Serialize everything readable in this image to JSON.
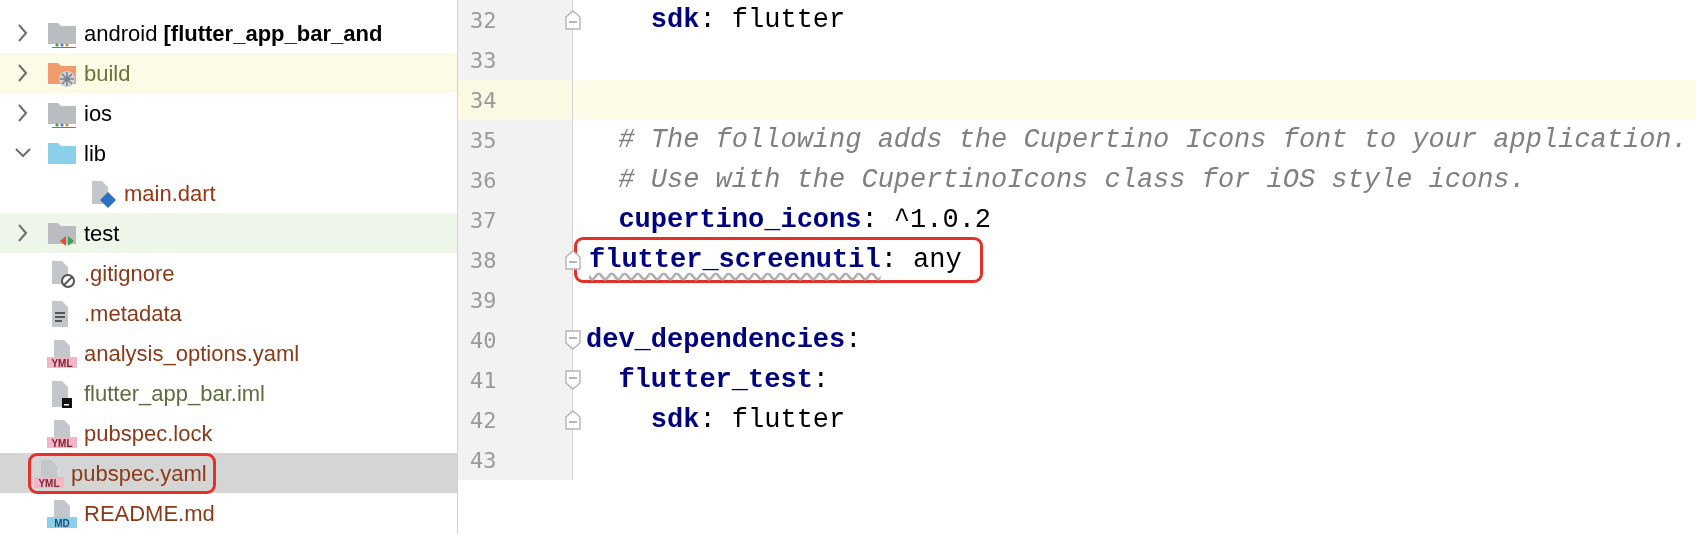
{
  "project_tree": {
    "items": [
      {
        "label": "android **[flutter_app_bar_and**",
        "kind": "module-folder",
        "expanded": false,
        "color": "#000000",
        "selected": false,
        "highlighted": false
      },
      {
        "label": "build",
        "kind": "excluded-folder",
        "expanded": false,
        "color": "#6b7337",
        "selected": false,
        "highlighted": false
      },
      {
        "label": "ios",
        "kind": "module-folder",
        "expanded": false,
        "color": "#000000",
        "selected": false,
        "highlighted": false
      },
      {
        "label": "lib",
        "kind": "source-folder",
        "expanded": true,
        "color": "#000000",
        "selected": false,
        "highlighted": false,
        "children": [
          {
            "label": "main.dart",
            "kind": "dart-file",
            "color": "#9a3412",
            "selected": false,
            "highlighted": false
          }
        ]
      },
      {
        "label": "test",
        "kind": "test-folder",
        "expanded": false,
        "color": "#000000",
        "selected": false,
        "highlighted": false
      },
      {
        "label": ".gitignore",
        "kind": "ignore-file",
        "color": "#8a3a17",
        "selected": false,
        "highlighted": false
      },
      {
        "label": ".metadata",
        "kind": "text-file",
        "color": "#8a3a17",
        "selected": false,
        "highlighted": false
      },
      {
        "label": "analysis_options.yaml",
        "kind": "badge-file",
        "badge": "YML",
        "color": "#8a3a17",
        "selected": false,
        "highlighted": false
      },
      {
        "label": "flutter_app_bar.iml",
        "kind": "iml-file",
        "color": "#5f6b3c",
        "selected": false,
        "highlighted": false
      },
      {
        "label": "pubspec.lock",
        "kind": "badge-file",
        "badge": "YML",
        "color": "#8a3a17",
        "selected": false,
        "highlighted": false
      },
      {
        "label": "pubspec.yaml",
        "kind": "badge-file",
        "badge": "YML",
        "color": "#8a3a17",
        "selected": true,
        "highlighted": true
      },
      {
        "label": "README.md",
        "kind": "badge-file",
        "badge": "MD",
        "color": "#8a3a17",
        "selected": false,
        "highlighted": false
      }
    ]
  },
  "editor": {
    "lines": [
      {
        "number": "32",
        "kind": "fold-end",
        "current": false,
        "highlighted": false,
        "tokens": [
          {
            "kind": "key",
            "text": "    sdk"
          },
          {
            "kind": "plain",
            "text": ": flutter"
          }
        ]
      },
      {
        "number": "33",
        "current": false,
        "highlighted": false
      },
      {
        "number": "34",
        "current": true,
        "highlighted": false
      },
      {
        "number": "35",
        "current": false,
        "highlighted": false,
        "tokens": [
          {
            "kind": "comment",
            "text": "  # The following adds the Cupertino Icons font to your application."
          }
        ]
      },
      {
        "number": "36",
        "current": false,
        "highlighted": false,
        "tokens": [
          {
            "kind": "comment",
            "text": "  # Use with the CupertinoIcons class for iOS style icons."
          }
        ]
      },
      {
        "number": "37",
        "current": false,
        "highlighted": false,
        "tokens": [
          {
            "kind": "key",
            "text": "  cupertino_icons"
          },
          {
            "kind": "plain",
            "text": ": ^1.0.2"
          }
        ]
      },
      {
        "number": "38",
        "kind": "fold-end",
        "current": false,
        "highlighted": true,
        "tokens": [
          {
            "kind": "key",
            "text": "flutter_screenutil"
          },
          {
            "kind": "plain",
            "text": ": any"
          }
        ]
      },
      {
        "number": "39",
        "current": false,
        "highlighted": false
      },
      {
        "number": "40",
        "kind": "fold-start",
        "current": false,
        "highlighted": false,
        "tokens": [
          {
            "kind": "key",
            "text": "dev_dependencies"
          },
          {
            "kind": "plain",
            "text": ":"
          }
        ]
      },
      {
        "number": "41",
        "kind": "fold-start",
        "current": false,
        "highlighted": false,
        "tokens": [
          {
            "kind": "key",
            "text": "  flutter_test"
          },
          {
            "kind": "plain",
            "text": ":"
          }
        ]
      },
      {
        "number": "42",
        "kind": "fold-end",
        "current": false,
        "highlighted": false,
        "tokens": [
          {
            "kind": "key",
            "text": "    sdk"
          },
          {
            "kind": "plain",
            "text": ": flutter"
          }
        ]
      },
      {
        "number": "43",
        "current": false,
        "highlighted": false
      }
    ]
  }
}
